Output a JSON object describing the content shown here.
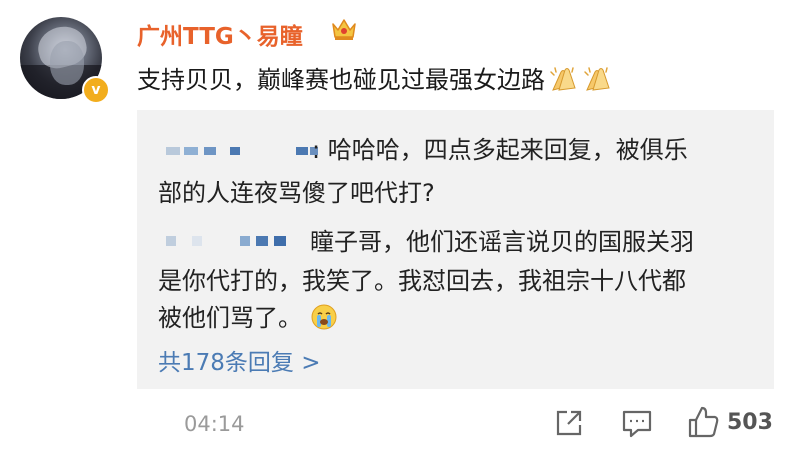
{
  "post": {
    "username": "广州TTG丶易瞳",
    "crown_icon": "crown-icon",
    "verified_icon": "v",
    "text": "支持贝贝，巅峰赛也碰见过最强女边路",
    "emoji": "clapping-hands-icon"
  },
  "replies": {
    "reply1_line1": ": 哈哈哈，四点多起来回复，被俱乐",
    "reply1_line2": "部的人连夜骂傻了吧代打?",
    "reply2_line1": "瞳子哥，他们还谣言说贝的国服关羽",
    "reply2_line2": "是你代打的，我笑了。我怼回去，我祖宗十八代都",
    "reply2_line3": "被他们骂了。",
    "reply2_emoji": "crying-face-icon",
    "more_label": "共178条回复 >"
  },
  "footer": {
    "timestamp": "04:14",
    "like_count": "503"
  },
  "colors": {
    "username": "#e8622b",
    "link": "#4b7bb4",
    "reply_bg": "#f2f2f2",
    "verified": "#f2ad1d"
  }
}
